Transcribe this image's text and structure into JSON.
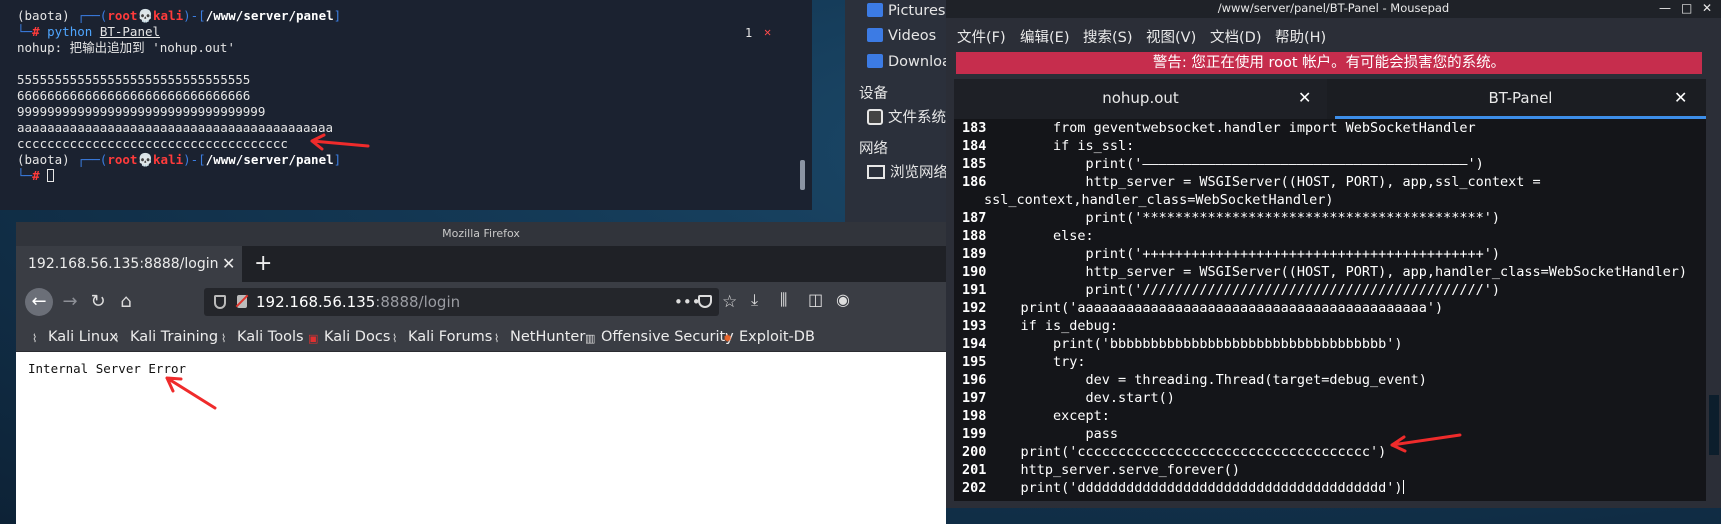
{
  "terminal": {
    "prompt_env": "(baota)",
    "prompt_user": "root",
    "prompt_host": "kali",
    "prompt_path": "/www/server/panel",
    "command": "python",
    "command_arg": "BT-Panel",
    "lines": [
      "nohup: 把输出追加到 'nohup.out'",
      "",
      "5555555555555555555555555555555",
      "6666666666666666666666666666666",
      "999999999999999999999999999999999",
      "aaaaaaaaaaaaaaaaaaaaaaaaaaaaaaaaaaaaaaaaaa",
      "cccccccccccccccccccccccccccccccccccc"
    ],
    "job_badge": "1",
    "job_close": "✕"
  },
  "files": {
    "items": [
      "Pictures",
      "Videos",
      "Downloads"
    ],
    "section_devices": "设备",
    "device_item": "文件系统",
    "section_network": "网络",
    "network_item": "浏览网络"
  },
  "firefox": {
    "window_title": "Mozilla Firefox",
    "tab_title": "192.168.56.135:8888/login",
    "url_host": "192.168.56.135",
    "url_rest": ":8888/login",
    "bookmarks": [
      "Kali Linux",
      "Kali Training",
      "Kali Tools",
      "Kali Docs",
      "Kali Forums",
      "NetHunter",
      "Offensive Security",
      "Exploit-DB"
    ],
    "page_text": "Internal Server Error"
  },
  "mousepad": {
    "window_title": "/www/server/panel/BT-Panel - Mousepad",
    "menu": [
      "文件(F)",
      "编辑(E)",
      "搜索(S)",
      "视图(V)",
      "文档(D)",
      "帮助(H)"
    ],
    "warning": "警告: 您正在使用 root 帐户。有可能会损害您的系统。",
    "tabs": [
      "nohup.out",
      "BT-Panel"
    ],
    "code_lines": [
      {
        "n": "183",
        "code": "        from geventwebsocket.handler import WebSocketHandler"
      },
      {
        "n": "184",
        "code": "        if is_ssl:"
      },
      {
        "n": "185",
        "code": "            print('————————————————————————————————————————')"
      },
      {
        "n": "186",
        "code": "            http_server = WSGIServer((HOST, PORT), app,ssl_context ="
      },
      {
        "n": "",
        "code": "ssl_context,handler_class=WebSocketHandler)"
      },
      {
        "n": "187",
        "code": "            print('******************************************')"
      },
      {
        "n": "188",
        "code": "        else:"
      },
      {
        "n": "189",
        "code": "            print('++++++++++++++++++++++++++++++++++++++++++')"
      },
      {
        "n": "190",
        "code": "            http_server = WSGIServer((HOST, PORT), app,handler_class=WebSocketHandler)"
      },
      {
        "n": "191",
        "code": "            print('//////////////////////////////////////////')"
      },
      {
        "n": "192",
        "code": "    print('aaaaaaaaaaaaaaaaaaaaaaaaaaaaaaaaaaaaaaaaaaa')"
      },
      {
        "n": "193",
        "code": "    if is_debug:"
      },
      {
        "n": "194",
        "code": "        print('bbbbbbbbbbbbbbbbbbbbbbbbbbbbbbbbbb')"
      },
      {
        "n": "195",
        "code": "        try:"
      },
      {
        "n": "196",
        "code": "            dev = threading.Thread(target=debug_event)"
      },
      {
        "n": "197",
        "code": "            dev.start()"
      },
      {
        "n": "198",
        "code": "        except:"
      },
      {
        "n": "199",
        "code": "            pass"
      },
      {
        "n": "200",
        "code": "    print('cccccccccccccccccccccccccccccccccccc')"
      },
      {
        "n": "201",
        "code": "    http_server.serve_forever()"
      },
      {
        "n": "202",
        "code": "    print('dddddddddddddddddddddddddddddddddddddd')"
      }
    ]
  },
  "colors": {
    "annotation_arrow": "#ef2b2b",
    "warning_bar": "#c62d4d",
    "tab_active_underline": "#3d8ee9"
  }
}
